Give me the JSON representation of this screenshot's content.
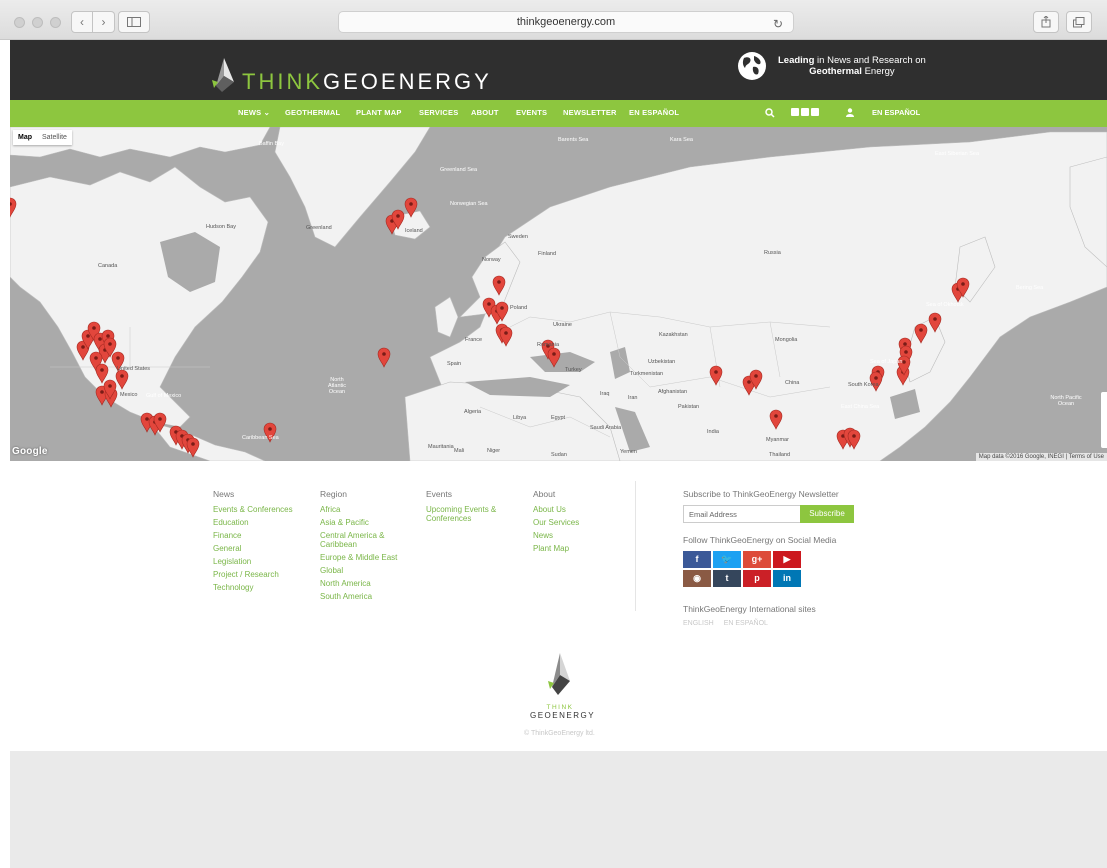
{
  "browser": {
    "url": "thinkgeoenergy.com"
  },
  "header": {
    "logo_think": "THINK",
    "logo_geoenergy": "GEOENERGY",
    "tagline_bold1": "Leading",
    "tagline_rest1": " in News and Research on",
    "tagline_bold2": "Geothermal",
    "tagline_rest2": " Energy"
  },
  "nav": {
    "items": [
      "NEWS",
      "GEOTHERMAL",
      "PLANT MAP",
      "SERVICES",
      "ABOUT",
      "EVENTS",
      "NEWSLETTER",
      "EN ESPAÑOL"
    ],
    "right_lang": "EN ESPAÑOL"
  },
  "map": {
    "type_map": "Map",
    "type_satellite": "Satellite",
    "google": "Google",
    "attribution": "Map data ©2016 Google, INEGI | Terms of Use",
    "labels": {
      "greenland": "Greenland",
      "iceland": "Iceland",
      "canada": "Canada",
      "hudson_bay": "Hudson Bay",
      "united_states": "United States",
      "north_atlantic": "North Atlantic Ocean",
      "russia": "Russia",
      "kazakhstan": "Kazakhstan",
      "mongolia": "Mongolia",
      "china": "China",
      "india": "India",
      "turkey": "Turkey",
      "iran": "Iran",
      "algeria": "Algeria",
      "libya": "Libya",
      "egypt": "Egypt",
      "saudi": "Saudi Arabia",
      "sweden": "Sweden",
      "finland": "Finland",
      "norway": "Norway",
      "poland": "Poland",
      "ukraine": "Ukraine",
      "france": "France",
      "spain": "Spain",
      "mexico": "Mexico",
      "north_pacific": "North Pacific Ocean",
      "south_korea": "South Korea",
      "east_china_sea": "East China Sea",
      "sea_okhotsk": "Sea of Okhotsk",
      "bering_sea": "Bering Sea",
      "mali": "Mali",
      "niger": "Niger",
      "sudan": "Sudan",
      "mauritania": "Mauritania",
      "afghanistan": "Afghanistan",
      "pakistan": "Pakistan",
      "iraq": "Iraq",
      "yemen": "Yemen",
      "thailand": "Thailand",
      "myanmar": "Myanmar",
      "romania": "Romania",
      "uzbekistan": "Uzbekistan",
      "turkmenistan": "Turkmenistan",
      "baffin_bay": "Baffin Bay",
      "greenland_sea": "Greenland Sea",
      "norwegian_sea": "Norwegian Sea",
      "barents_sea": "Barents Sea",
      "kara_sea": "Kara Sea",
      "east_siberian_sea": "East Siberian Sea",
      "gulf_mexico": "Gulf of Mexico",
      "caribbean": "Caribbean Sea",
      "sea_japan": "Sea of Japan"
    }
  },
  "footer": {
    "cols": [
      {
        "head": "News",
        "links": [
          "Events & Conferences",
          "Education",
          "Finance",
          "General",
          "Legislation",
          "Project / Research",
          "Technology"
        ]
      },
      {
        "head": "Region",
        "links": [
          "Africa",
          "Asia & Pacific",
          "Central America &",
          "Caribbean",
          "Europe & Middle East",
          "Global",
          "North America",
          "South America"
        ]
      },
      {
        "head": "Events",
        "links": [
          "Upcoming Events &",
          "Conferences"
        ]
      },
      {
        "head": "About",
        "links": [
          "About Us",
          "Our Services",
          "News",
          "Plant Map"
        ]
      }
    ],
    "subscribe_title": "Subscribe to ThinkGeoEnergy Newsletter",
    "email_placeholder": "Email Address",
    "subscribe_button": "Subscribe",
    "follow_title": "Follow ThinkGeoEnergy on Social Media",
    "social": [
      {
        "name": "facebook-icon",
        "glyph": "f",
        "color": "#3b5998"
      },
      {
        "name": "twitter-icon",
        "glyph": "🐦",
        "color": "#1da1f2"
      },
      {
        "name": "google-plus-icon",
        "glyph": "g+",
        "color": "#dd4b39"
      },
      {
        "name": "youtube-icon",
        "glyph": "▶",
        "color": "#cc181e"
      },
      {
        "name": "instagram-icon",
        "glyph": "◉",
        "color": "#8a5a44"
      },
      {
        "name": "tumblr-icon",
        "glyph": "t",
        "color": "#35465c"
      },
      {
        "name": "pinterest-icon",
        "glyph": "p",
        "color": "#cb2027"
      },
      {
        "name": "linkedin-icon",
        "glyph": "in",
        "color": "#0077b5"
      }
    ],
    "intl_title": "ThinkGeoEnergy International sites",
    "intl_links": [
      "ENGLISH",
      "EN ESPAÑOL"
    ],
    "logo_think": "THINK",
    "logo_geoenergy": "GEOENERGY",
    "copyright": "© ThinkGeoEnergy ltd."
  },
  "colors": {
    "brand_green": "#8dc63f",
    "header_dark": "#2f2f2f",
    "map_water": "#aaaaaa",
    "map_land": "#f2f2f2",
    "pin_red": "#e2463c"
  }
}
